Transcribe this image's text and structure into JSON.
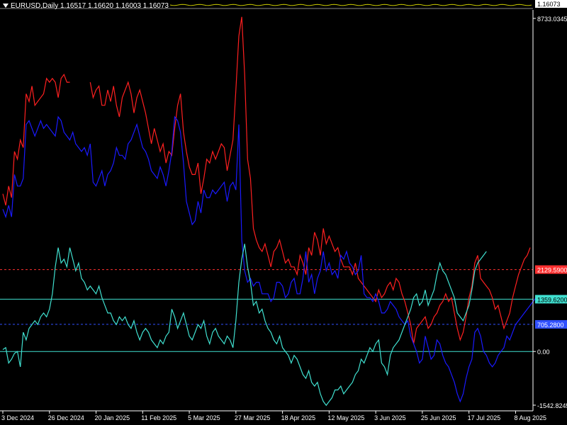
{
  "header": {
    "symbol": "EURUSD,Daily",
    "ohlc": "1.16517 1.16620 1.16003 1.16073",
    "price_label": "1.16073"
  },
  "colors": {
    "background": "#000000",
    "series_red": "#ff2020",
    "series_blue": "#1a1aff",
    "series_cyan": "#40e0d0",
    "level_red": "#ff3030",
    "level_cyan": "#40e0d0",
    "level_blue": "#3050ff",
    "axis_text": "#ffffff"
  },
  "chart_data": {
    "type": "line",
    "title": "",
    "ylim": [
      -1542.8245,
      8733.0345
    ],
    "scale_labels": [
      "8733.0345",
      "0.00",
      "-1542.8245"
    ],
    "x_labels": [
      "3 Dec 2024",
      "26 Dec 2024",
      "20 Jan 2025",
      "11 Feb 2025",
      "5 Mar 2025",
      "27 Mar 2025",
      "18 Apr 2025",
      "12 May 2025",
      "3 Jun 2025",
      "25 Jun 2025",
      "17 Jul 2025",
      "8 Aug 2025"
    ],
    "x_label_index": [
      0,
      16,
      32,
      48,
      64,
      80,
      96,
      112,
      128,
      144,
      160,
      176
    ],
    "levels": [
      {
        "value": 2129.59,
        "label": "2129.5900",
        "color": "#ff3030",
        "style": "dashed"
      },
      {
        "value": 1359.62,
        "label": "1359.6200",
        "color": "#40e0d0",
        "style": "solid"
      },
      {
        "value": 705.28,
        "label": "705.2800",
        "color": "#3050ff",
        "style": "dashed"
      },
      {
        "value": 0,
        "label": "0.00",
        "color": "#40e0d0",
        "style": "solid"
      }
    ],
    "series": [
      {
        "color": "#ff2020",
        "values": [
          4100,
          3800,
          4300,
          4000,
          5200,
          5000,
          5500,
          5300,
          6700,
          6500,
          6900,
          6400,
          6500,
          6600,
          6700,
          7100,
          7000,
          7100,
          7000,
          6600,
          7100,
          7200,
          7000,
          7000,
          null,
          null,
          null,
          null,
          null,
          null,
          7000,
          6600,
          6800,
          6900,
          6400,
          6400,
          6800,
          6500,
          6900,
          6400,
          6100,
          6600,
          6800,
          7000,
          6700,
          6200,
          6600,
          6800,
          6500,
          6200,
          5800,
          5400,
          5800,
          5500,
          5200,
          5400,
          4900,
          5200,
          5100,
          5800,
          6400,
          6700,
          5700,
          5200,
          4800,
          4600,
          4600,
          4900,
          4100,
          4500,
          5000,
          4900,
          5200,
          5000,
          5200,
          5400,
          5300,
          4700,
          5100,
          5500,
          6800,
          8200,
          8700,
          7200,
          5000,
          4500,
          3200,
          2900,
          2700,
          2600,
          2800,
          2500,
          2200,
          2600,
          2700,
          2900,
          2600,
          2300,
          2400,
          2200,
          2200,
          2000,
          2500,
          2300,
          2000,
          2700,
          2500,
          3100,
          2900,
          2500,
          3200,
          2800,
          3000,
          2800,
          2600,
          2700,
          2400,
          2200,
          2200,
          2200,
          2000,
          2300,
          1900,
          1800,
          1700,
          1600,
          1500,
          1400,
          1300,
          1600,
          1400,
          1500,
          1700,
          1800,
          1600,
          1900,
          1800,
          1500,
          1300,
          1000,
          700,
          200,
          600,
          700,
          800,
          900,
          600,
          700,
          900,
          1000,
          1200,
          1300,
          1500,
          1300,
          1400,
          1000,
          600,
          300,
          500,
          900,
          1400,
          1700,
          2300,
          2500,
          1900,
          1800,
          1700,
          1600,
          1400,
          1100,
          1200,
          900,
          600,
          800,
          1000,
          1400,
          1700,
          2000,
          2200,
          2400,
          2500,
          2700
        ]
      },
      {
        "color": "#1a1aff",
        "values": [
          3700,
          3500,
          3800,
          3500,
          4600,
          4300,
          4300,
          4500,
          5900,
          6000,
          5800,
          5600,
          5800,
          6000,
          5800,
          5900,
          5800,
          5700,
          5600,
          6100,
          6000,
          5700,
          5600,
          5500,
          5700,
          5400,
          5300,
          5200,
          5300,
          5100,
          5400,
          4400,
          4300,
          4500,
          4700,
          4300,
          4600,
          4700,
          4900,
          5300,
          5100,
          5100,
          5000,
          5400,
          5500,
          5700,
          5900,
          5600,
          5300,
          5200,
          5000,
          4700,
          4600,
          4500,
          4800,
          4600,
          4300,
          4700,
          5200,
          6100,
          6000,
          5700,
          4900,
          3900,
          3600,
          3300,
          3400,
          3900,
          3600,
          4200,
          4000,
          4000,
          4200,
          4100,
          4200,
          4300,
          4400,
          3900,
          4300,
          4400,
          4200,
          5900,
          2900,
          2100,
          1800,
          1900,
          1700,
          1800,
          1800,
          1500,
          1500,
          1500,
          1300,
          1400,
          1800,
          1800,
          1700,
          1400,
          1500,
          1800,
          1900,
          1500,
          1500,
          1900,
          2600,
          1800,
          2000,
          1500,
          1900,
          2100,
          2600,
          2100,
          2300,
          2000,
          2100,
          1900,
          2500,
          2400,
          2600,
          2300,
          2200,
          2000,
          2100,
          2500,
          1500,
          1400,
          1400,
          1300,
          1500,
          1300,
          1000,
          1000,
          1100,
          1300,
          1200,
          1100,
          900,
          800,
          700,
          800,
          400,
          200,
          0,
          -300,
          -200,
          400,
          100,
          -200,
          -100,
          300,
          200,
          -100,
          -300,
          -400,
          -600,
          -800,
          -1100,
          -1300,
          -1100,
          -700,
          -400,
          -200,
          500,
          600,
          400,
          0,
          -100,
          -300,
          -400,
          -300,
          -100,
          0,
          100,
          400,
          300,
          500,
          700,
          800,
          900,
          1000,
          1100,
          1200,
          1300,
          1400
        ]
      },
      {
        "color": "#40e0d0",
        "values": [
          50,
          100,
          -300,
          -200,
          -50,
          0,
          -400,
          500,
          300,
          600,
          700,
          800,
          700,
          900,
          1000,
          900,
          1100,
          1500,
          2200,
          2700,
          2300,
          2400,
          2200,
          2700,
          2400,
          2100,
          2300,
          1900,
          1800,
          1600,
          1700,
          1600,
          1500,
          1700,
          1400,
          1200,
          1000,
          1000,
          800,
          700,
          900,
          800,
          900,
          700,
          600,
          800,
          500,
          300,
          500,
          600,
          500,
          300,
          200,
          100,
          300,
          200,
          400,
          500,
          1100,
          900,
          600,
          800,
          1000,
          700,
          400,
          300,
          500,
          700,
          600,
          800,
          400,
          200,
          500,
          600,
          400,
          300,
          200,
          400,
          300,
          100,
          800,
          1800,
          2400,
          2800,
          2200,
          1800,
          1200,
          1300,
          1000,
          1100,
          800,
          600,
          500,
          300,
          200,
          400,
          100,
          0,
          -100,
          -300,
          -100,
          -200,
          -400,
          -600,
          -700,
          -500,
          -800,
          -900,
          -800,
          -1100,
          -1300,
          -1400,
          -1300,
          -1200,
          -1000,
          -1000,
          -900,
          -1100,
          -1000,
          -900,
          -800,
          -600,
          -500,
          -200,
          -300,
          -100,
          100,
          0,
          200,
          300,
          -300,
          -400,
          -600,
          -100,
          100,
          200,
          300,
          500,
          700,
          900,
          1100,
          1400,
          1500,
          1200,
          1300,
          1600,
          1200,
          1400,
          1600,
          2000,
          2300,
          2100,
          2000,
          1800,
          1600,
          1400,
          1000,
          900,
          800,
          1000,
          1200,
          1600,
          2100,
          2300,
          2400,
          2500,
          2600
        ]
      }
    ],
    "mini_line": {
      "color": "#c8c800",
      "label": "1.16073"
    }
  }
}
